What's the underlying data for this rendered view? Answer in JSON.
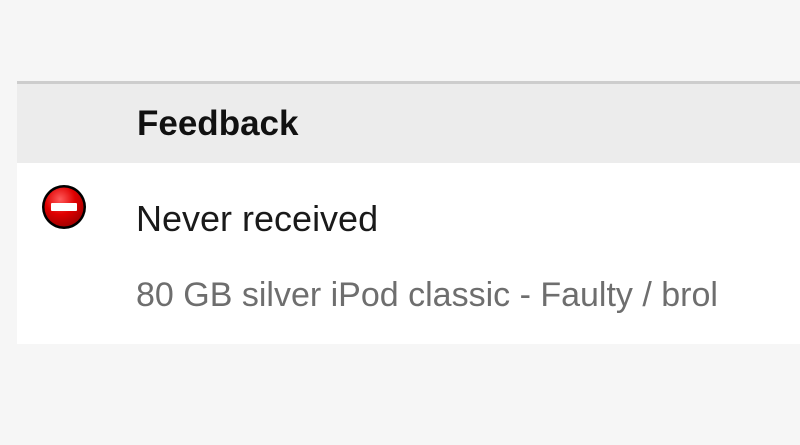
{
  "table": {
    "header": {
      "feedback_label": "Feedback"
    },
    "rows": [
      {
        "rating_icon": "negative-feedback-icon",
        "rating_color": "#e00000",
        "comment": "Never received",
        "item_title": "80 GB silver iPod classic - Faulty / brol"
      }
    ]
  }
}
